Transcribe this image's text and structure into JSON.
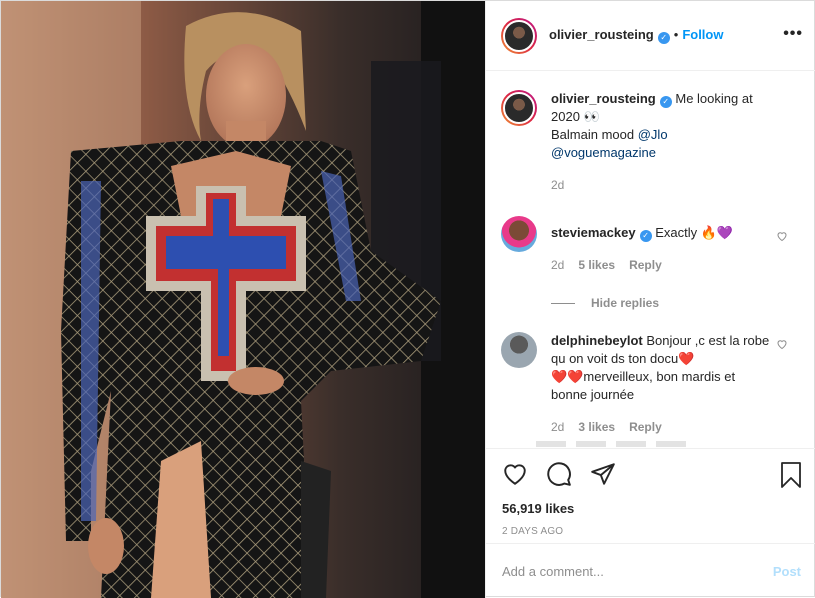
{
  "header": {
    "username": "olivier_rousteing",
    "separator": "•",
    "follow_label": "Follow",
    "more_label": "•••"
  },
  "caption": {
    "username": "olivier_rousteing",
    "text_line": "Me looking at 2020",
    "emoji": "👀",
    "mood_text": "Balmain mood",
    "mention1": "@Jlo",
    "mention2": "@voguemagazine",
    "time": "2d"
  },
  "comments": [
    {
      "username": "steviemackey",
      "text": "Exactly",
      "emoji": "🔥💜",
      "time": "2d",
      "likes": "5 likes",
      "reply_label": "Reply"
    },
    {
      "username": "delphinebeylot",
      "text_a": "Bonjour ,c est la robe qu on voit ds ton docu",
      "emoji_a": "❤️",
      "emoji_b": "❤️❤️",
      "text_b": "merveilleux, bon mardis et bonne journée",
      "time": "2d",
      "likes": "3 likes",
      "reply_label": "Reply"
    }
  ],
  "hide_replies_label": "Hide replies",
  "actions": {
    "likes_count": "56,919 likes",
    "date_label": "2 DAYS AGO"
  },
  "add_comment": {
    "placeholder": "Add a comment...",
    "post_label": "Post"
  },
  "colors": {
    "accent": "#0095f6",
    "verified": "#3897f0",
    "muted": "#8e8e8e",
    "post_disabled": "#b2dffc"
  },
  "icons": [
    "heart-icon",
    "comment-icon",
    "share-icon",
    "bookmark-icon",
    "verified-icon",
    "more-icon"
  ]
}
